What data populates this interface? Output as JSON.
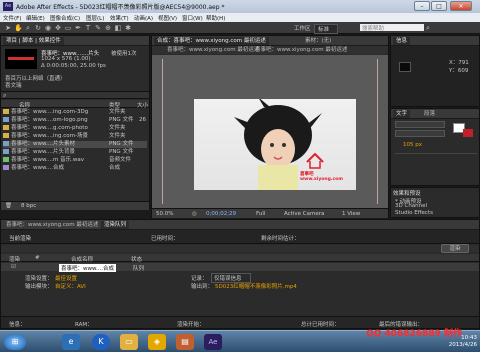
{
  "window": {
    "app_icon": "Ae",
    "title": "Adobe After Effects - 5D023红帽帽不羡像彩照片版@AEC54@9000.aep *",
    "controls": [
      "–",
      "□",
      "✕"
    ]
  },
  "menu": [
    "文件(F)",
    "编辑(E)",
    "图像合成(C)",
    "图层(L)",
    "效果(T)",
    "动画(A)",
    "视图(V)",
    "窗口(W)",
    "帮助(H)"
  ],
  "toolbar": {
    "workspace_label": "工作区",
    "workspace_value": "标准",
    "search_placeholder": "搜索帮助"
  },
  "project_panel": {
    "tabs": [
      "项目 | 脚本 | 效果控件"
    ],
    "preview_name": "喜事吧：www.......片头",
    "preview_info": "1024 x 576 (1.00)",
    "preview_duration": "Δ 0:00:05:00, 25.00 fps",
    "preview_used": "被使用1次",
    "preview_line2": "喜百万以上网络（直通）",
    "preview_line3": "喜文瑞",
    "columns": [
      "名称",
      "类型",
      "大小"
    ],
    "items": [
      {
        "name": "喜事吧：www....ing.com-3Dg",
        "type": "文件夹",
        "size": ""
      },
      {
        "name": "喜事吧：www....om-logo.png",
        "type": "PNG 文件",
        "size": "26"
      },
      {
        "name": "喜事吧：www....g.com-photo",
        "type": "文件夹",
        "size": ""
      },
      {
        "name": "喜事吧：www....ing.com-场景",
        "type": "文件夹",
        "size": ""
      },
      {
        "name": "喜事吧：www....片头素材",
        "type": "PNG 文件",
        "size": ""
      },
      {
        "name": "喜事吧：www....片头背景",
        "type": "PNG 文件",
        "size": ""
      },
      {
        "name": "喜事吧：www....m 音乐.wav",
        "type": "音频文件",
        "size": ""
      },
      {
        "name": "喜事吧：www....合成",
        "type": "合成",
        "size": ""
      }
    ],
    "footer": "8 bpc"
  },
  "composition_panel": {
    "tabs": [
      "合成：喜事吧：www.xiyong.com 最初运述",
      "素材：(无)"
    ],
    "subtabs": [
      "喜事吧：www.xiyong.com 最初运述",
      "喜事吧：www.xiyong.com 最初运述"
    ],
    "stamp_text": "喜事吧 www.xiyong.com",
    "footer": [
      "50.0%",
      "0;00;02;29",
      "Full",
      "Active Camera",
      "1 View"
    ]
  },
  "right_panels": {
    "info_tab": "信息",
    "x": "X：791",
    "y": "Y：609",
    "text_tab": "文字",
    "text_tab2": "段落",
    "font_size": "105 px",
    "effects_tab": "效果和预设",
    "effects_items": [
      "* 动画预设",
      "3D Channel",
      "Audio",
      "Blur & Sharpen",
      "Channel",
      "Color Correction",
      "Distort",
      "Studio Effects"
    ]
  },
  "render_queue": {
    "tabs": [
      "喜事吧：www.xiyong.com 最初运述",
      "渲染队列"
    ],
    "header": "当前渲染",
    "elapsed_label": "已用时间：",
    "remaining_label": "剩余时间估计：",
    "render_button": "渲染",
    "columns": [
      "渲染",
      "#",
      "合成名称",
      "状态"
    ],
    "item_name": "喜事吧：www....合成",
    "item_status": "队列",
    "render_settings_label": "渲染设置：",
    "render_settings_value": "最佳设置",
    "output_module_label": "输出模块：",
    "output_module_value": "自定义：AVI",
    "log_label": "记录：",
    "log_value": "仅错误信息",
    "output_to_label": "输出到：",
    "output_to_value": "5D023红帽帽不羡像彩照片.mp4",
    "status_bar": [
      "信息：",
      "RAM：",
      "渲染开始：",
      "总计已用时间：",
      "最后的错误输出："
    ]
  },
  "taskbar": {
    "icons": [
      "windows-start",
      "ie",
      "k-app",
      "folder",
      "messenger",
      "bookmark",
      "after-effects"
    ],
    "clock_time": "10:43",
    "clock_date": "2013/4/26"
  },
  "watermark": "QQ 406826889 制作"
}
